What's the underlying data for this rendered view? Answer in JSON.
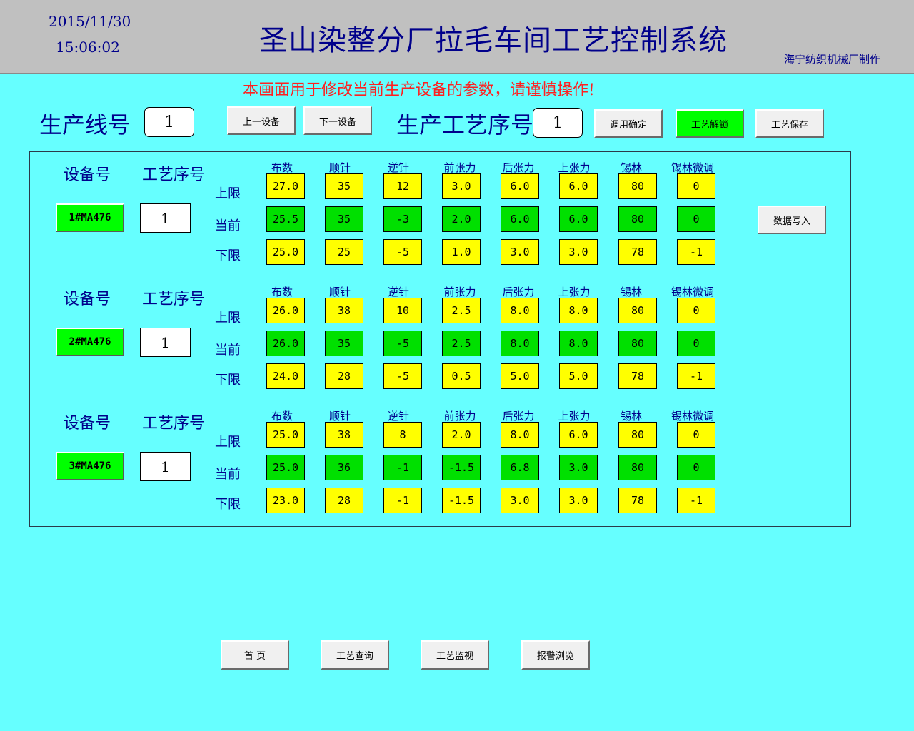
{
  "header": {
    "date": "2015/11/30",
    "time": "15:06:02",
    "title": "圣山染整分厂拉毛车间工艺控制系统",
    "maker": "海宁纺织机械厂制作"
  },
  "warning": "本画面用于修改当前生产设备的参数，请谨慎操作!",
  "controls": {
    "line_label": "生产线号",
    "line_value": "1",
    "prev_device": "上一设备",
    "next_device": "下一设备",
    "seq_label": "生产工艺序号",
    "seq_value": "1",
    "call_confirm": "调用确定",
    "unlock": "工艺解锁",
    "save": "工艺保存"
  },
  "columns": [
    "布数",
    "顺针",
    "逆针",
    "前张力",
    "后张力",
    "上张力",
    "锡林",
    "锡林微调"
  ],
  "row_labels": {
    "upper": "上限",
    "current": "当前",
    "lower": "下限"
  },
  "device_label": "设备号",
  "process_seq_label": "工艺序号",
  "write_button": "数据写入",
  "devices": [
    {
      "id": "1#MA476",
      "seq": "1",
      "upper": [
        "27.0",
        "35",
        "12",
        "3.0",
        "6.0",
        "6.0",
        "80",
        "0"
      ],
      "current": [
        "25.5",
        "35",
        "-3",
        "2.0",
        "6.0",
        "6.0",
        "80",
        "0"
      ],
      "lower": [
        "25.0",
        "25",
        "-5",
        "1.0",
        "3.0",
        "3.0",
        "78",
        "-1"
      ]
    },
    {
      "id": "2#MA476",
      "seq": "1",
      "upper": [
        "26.0",
        "38",
        "10",
        "2.5",
        "8.0",
        "8.0",
        "80",
        "0"
      ],
      "current": [
        "26.0",
        "35",
        "-5",
        "2.5",
        "8.0",
        "8.0",
        "80",
        "0"
      ],
      "lower": [
        "24.0",
        "28",
        "-5",
        "0.5",
        "5.0",
        "5.0",
        "78",
        "-1"
      ]
    },
    {
      "id": "3#MA476",
      "seq": "1",
      "upper": [
        "25.0",
        "38",
        "8",
        "2.0",
        "8.0",
        "6.0",
        "80",
        "0"
      ],
      "current": [
        "25.0",
        "36",
        "-1",
        "-1.5",
        "6.8",
        "3.0",
        "80",
        "0"
      ],
      "lower": [
        "23.0",
        "28",
        "-1",
        "-1.5",
        "3.0",
        "3.0",
        "78",
        "-1"
      ]
    }
  ],
  "nav": {
    "home": "首  页",
    "query": "工艺查询",
    "monitor": "工艺监视",
    "alarm": "报警浏览"
  },
  "colors": {
    "background": "#66ffff",
    "header": "#c0c0c0",
    "limit_cell": "#ffff00",
    "current_cell": "#00e000",
    "device_button": "#00ff00",
    "warning_text": "#ff2020",
    "label_text": "#00008b"
  }
}
